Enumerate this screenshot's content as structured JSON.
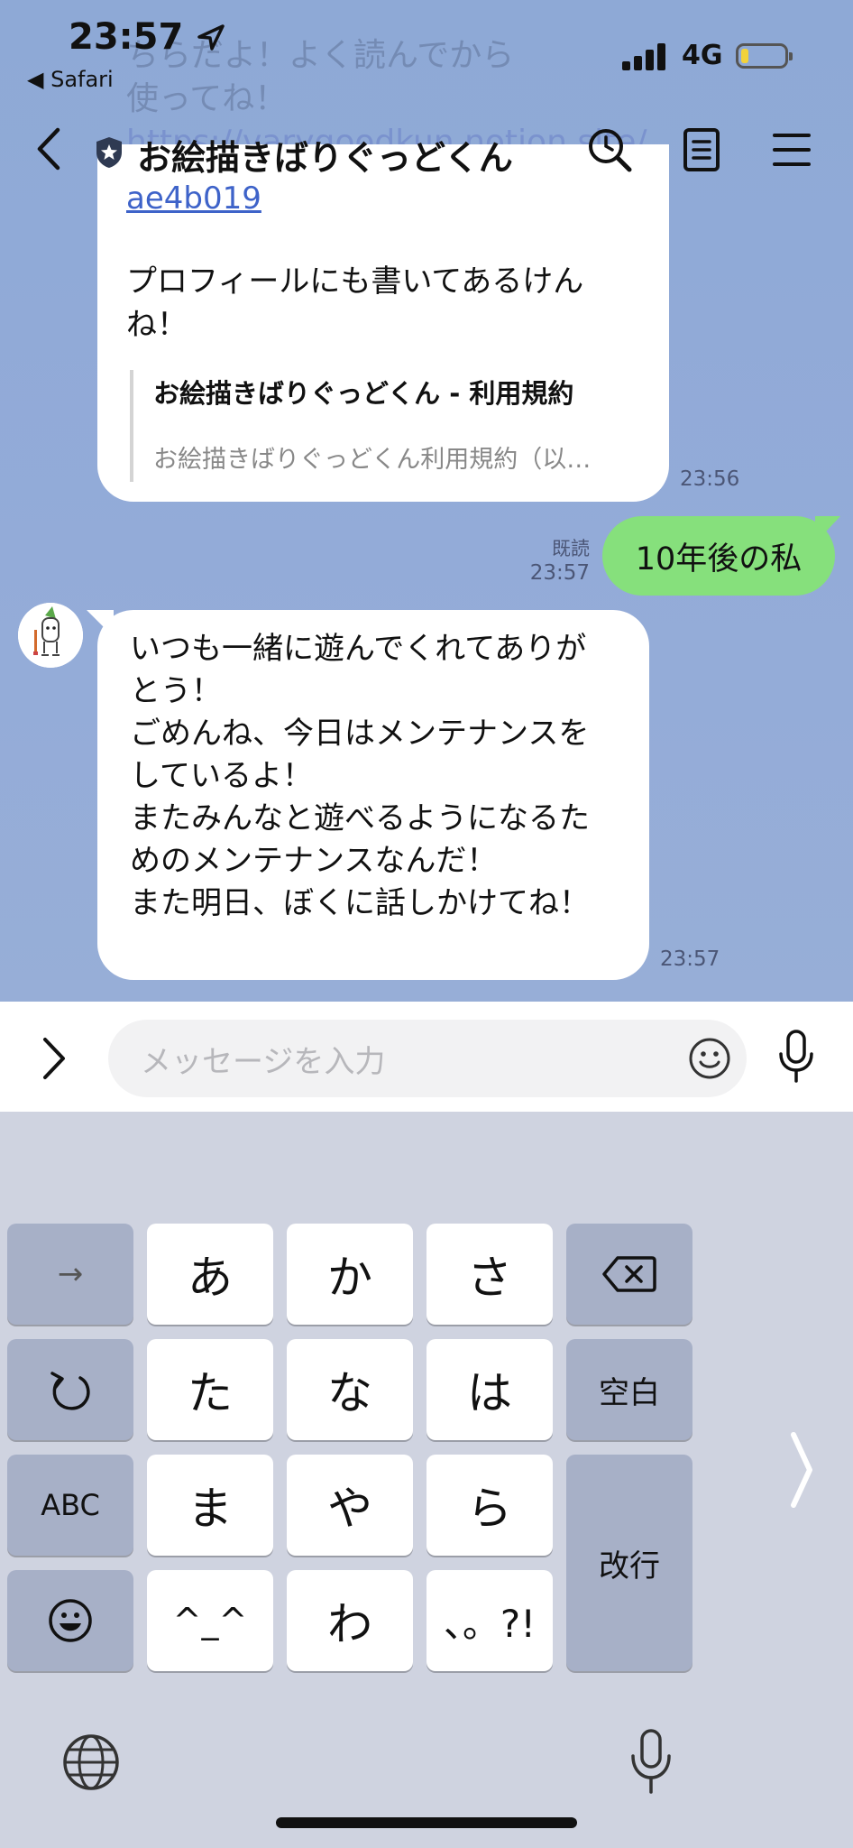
{
  "status_bar": {
    "time": "23:57",
    "back_app": "◀ Safari",
    "network": "4G"
  },
  "header": {
    "title": "お絵描きばりぐっどくん"
  },
  "background_text": {
    "lines": [
      "ちらだよ！よく読んでから",
      "使ってね！"
    ],
    "link": "https://varygoodkun.notion.site/"
  },
  "messages": {
    "first": {
      "link_tail": "ae4b019",
      "text": "プロフィールにも書いてあるけんね！",
      "preview_title": "お絵描きばりぐっどくん - 利用規約",
      "preview_desc": "お絵描きばりぐっどくん利用規約（以…",
      "time": "23:56"
    },
    "mine": {
      "text": "10年後の私",
      "read": "既読",
      "time": "23:57"
    },
    "reply": {
      "lines": [
        "いつも一緒に遊んでくれてありが",
        "とう！",
        "ごめんね、今日はメンテナンスを",
        "しているよ！",
        "またみんなと遊べるようになるた",
        "めのメンテナンスなんだ！",
        "また明日、ぼくに話しかけてね！"
      ],
      "time": "23:57"
    }
  },
  "input": {
    "placeholder": "メッセージを入力"
  },
  "keyboard": {
    "row1": [
      "→",
      "あ",
      "か",
      "さ",
      "⌫"
    ],
    "row2": [
      "↺",
      "た",
      "な",
      "は",
      "空白"
    ],
    "row3": [
      "ABC",
      "ま",
      "や",
      "ら",
      "改行"
    ],
    "row4": [
      "☺",
      "^_^",
      "わ",
      "、。?!"
    ]
  },
  "colors": {
    "chat_bg": "#8fa8d4",
    "my_bubble": "#86e07c",
    "link": "#3e63c9",
    "keyboard_bg": "#cfd3e0",
    "function_key": "#a7b0c7"
  }
}
